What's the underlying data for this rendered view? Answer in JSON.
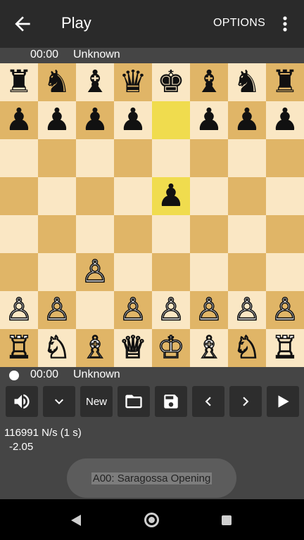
{
  "appbar": {
    "title": "Play",
    "options_label": "OPTIONS",
    "back_icon": "arrow-left-icon",
    "more_icon": "more-vert-icon"
  },
  "top_player": {
    "time": "00:00",
    "name": "Unknown"
  },
  "bottom_player": {
    "time": "00:00",
    "name": "Unknown"
  },
  "board": {
    "ranks": [
      [
        "♜",
        "♞",
        "♝",
        "♛",
        "♚",
        "♝",
        "♞",
        "♜"
      ],
      [
        "♟",
        "♟",
        "♟",
        "♟",
        "",
        "♟",
        "♟",
        "♟"
      ],
      [
        "",
        "",
        "",
        "",
        "",
        "",
        "",
        ""
      ],
      [
        "",
        "",
        "",
        "",
        "♟",
        "",
        "",
        ""
      ],
      [
        "",
        "",
        "",
        "",
        "",
        "",
        "",
        ""
      ],
      [
        "",
        "",
        "♙",
        "",
        "",
        "",
        "",
        ""
      ],
      [
        "♙",
        "♙",
        "",
        "♙",
        "♙",
        "♙",
        "♙",
        "♙"
      ],
      [
        "♖",
        "♘",
        "♗",
        "♕",
        "♔",
        "♗",
        "♘",
        "♖"
      ]
    ],
    "highlighted_squares": [
      "e7",
      "e5"
    ],
    "colors": {
      "light": "#fae7c4",
      "dark": "#e0b567",
      "highlight": "#f0dc4e"
    }
  },
  "toolbar": {
    "sound_icon": "volume-up-icon",
    "expand_icon": "chevron-down-icon",
    "new_label": "New",
    "open_icon": "folder-open-icon",
    "save_icon": "floppy-disk-icon",
    "prev_icon": "chevron-left-icon",
    "next_icon": "chevron-right-icon",
    "play_icon": "play-icon"
  },
  "engine": {
    "speed": "116991 N/s (1 s)",
    "score": "-2.05"
  },
  "opening": {
    "text": "A00: Saragossa Opening"
  }
}
